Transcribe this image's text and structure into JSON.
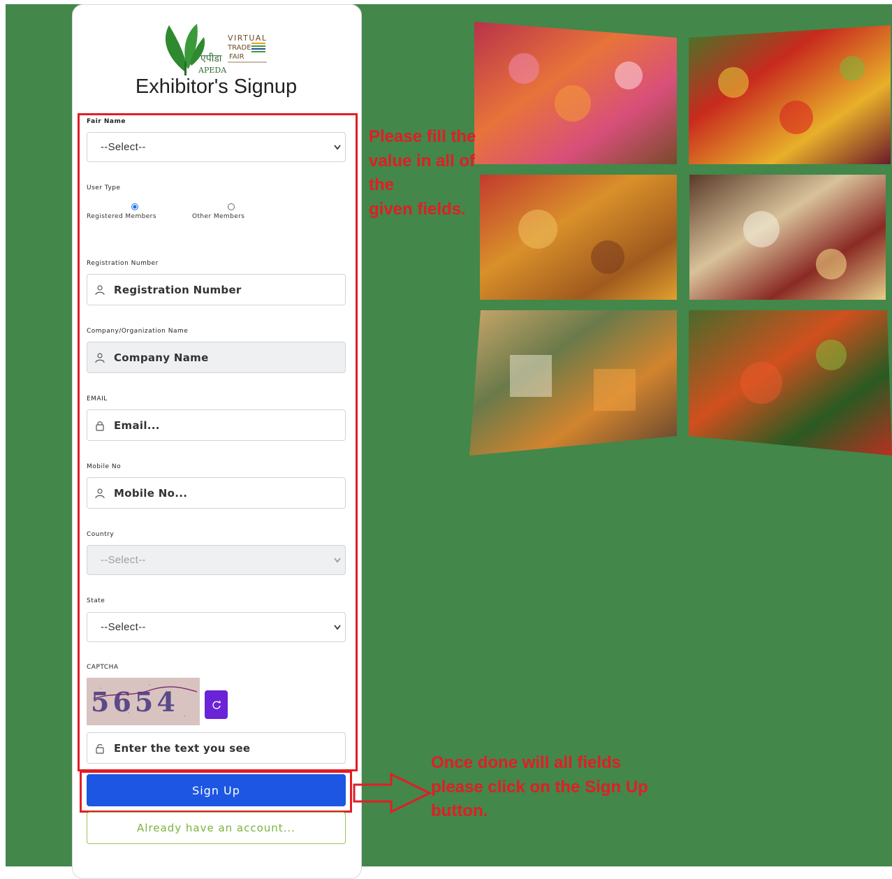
{
  "logo": {
    "line1": "VIRTUAL",
    "line2": "TRADE",
    "line3": "FAIR",
    "hindi": "एपीडा",
    "org": "APEDA"
  },
  "page_title": "Exhibitor's Signup",
  "form": {
    "fair_name": {
      "label": "Fair Name",
      "selected": "--Select--"
    },
    "user_type": {
      "label": "User Type",
      "options": [
        "Registered Members",
        "Other Members"
      ],
      "selected": "Registered Members"
    },
    "registration_number": {
      "label": "Registration Number",
      "placeholder": "Registration Number"
    },
    "company_name": {
      "label": "Company/Organization Name",
      "placeholder": "Company Name"
    },
    "email": {
      "label": "EMAIL",
      "placeholder": "Email..."
    },
    "mobile": {
      "label": "Mobile No",
      "placeholder": "Mobile No..."
    },
    "country": {
      "label": "Country",
      "selected": "--Select--"
    },
    "state": {
      "label": "State",
      "selected": "--Select--"
    },
    "captcha": {
      "label": "CAPTCHA",
      "code": "5654",
      "placeholder": "Enter the text you see"
    },
    "signup_label": "Sign Up",
    "already_label": "Already have an account..."
  },
  "annotations": {
    "fill_note": [
      "Please fill the",
      "value in all of",
      "the",
      "given fields."
    ],
    "signup_note": [
      "Once done will all fields",
      "please click on the Sign Up",
      "button."
    ]
  },
  "colors": {
    "background_green": "#43874a",
    "annotation_red": "#e21d26",
    "signup_blue": "#1c56e3",
    "refresh_purple": "#6a23d6"
  }
}
